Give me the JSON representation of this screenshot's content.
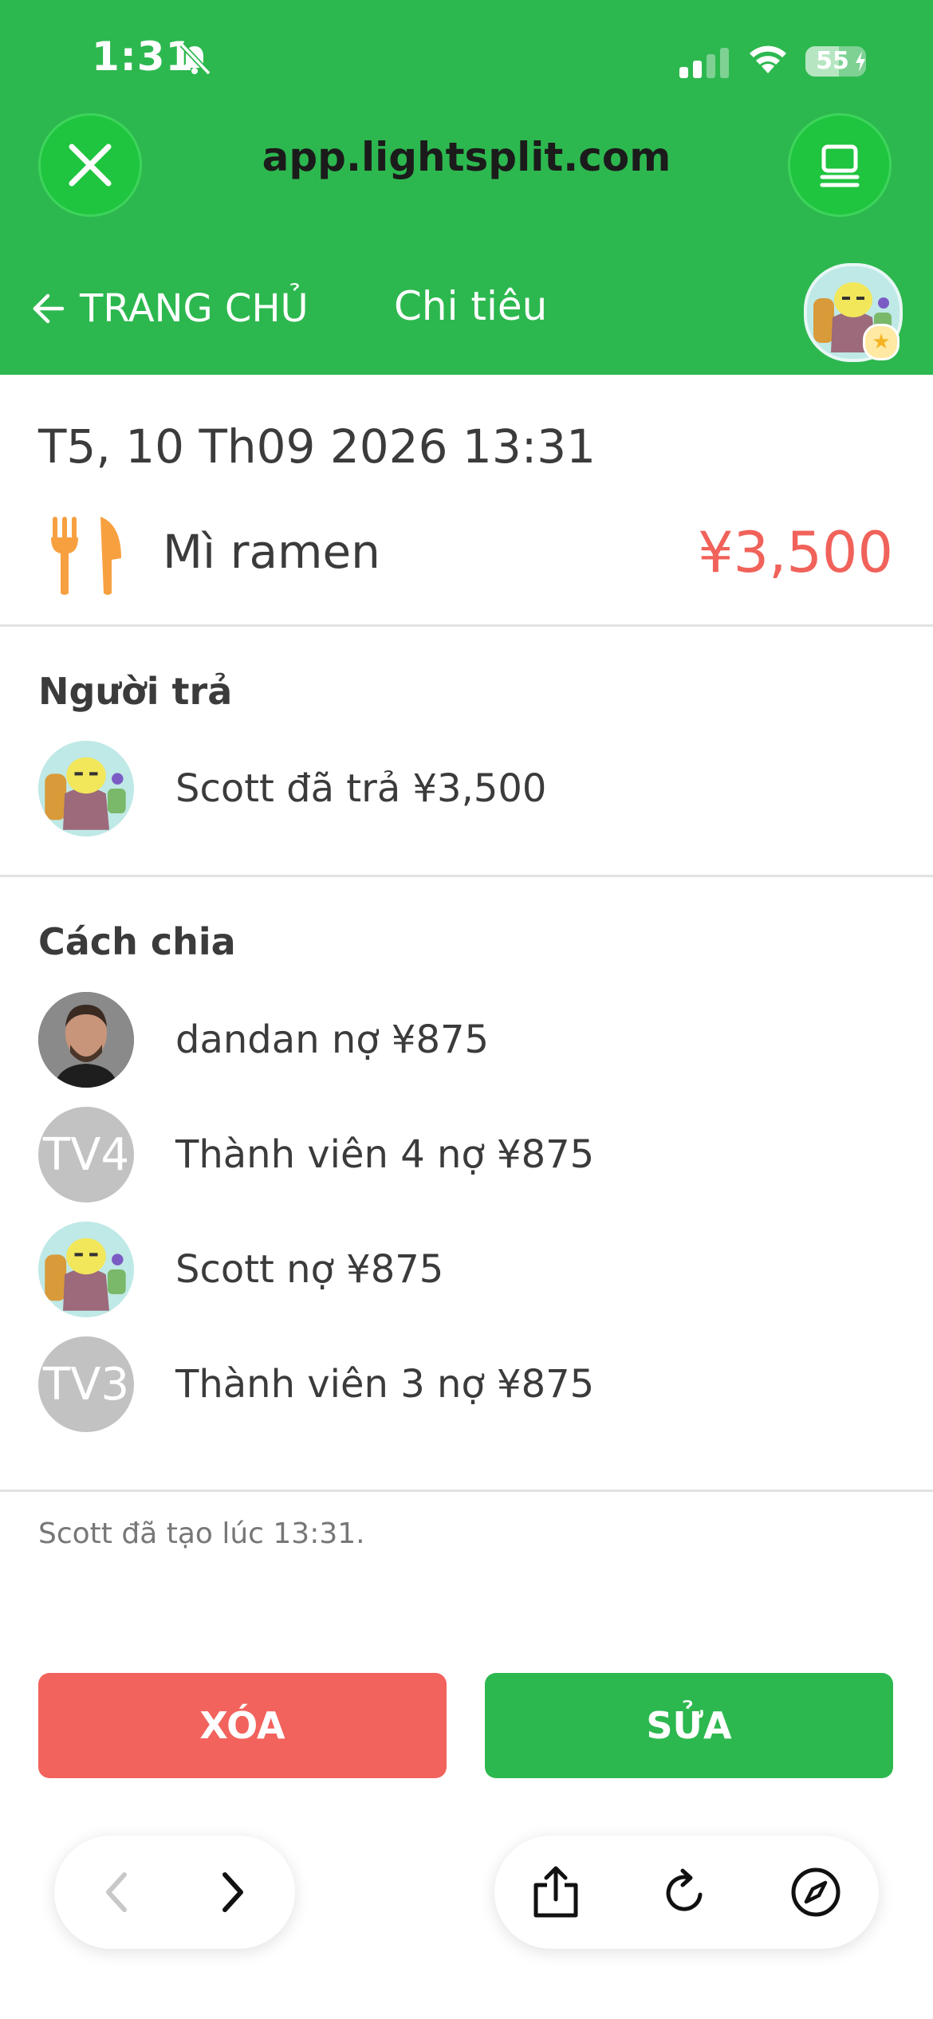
{
  "status_bar": {
    "time": "1:31",
    "battery": "55",
    "battery_level": 0.55
  },
  "browser": {
    "url": "app.lightsplit.com"
  },
  "nav": {
    "back_label": "TRANG CHỦ",
    "title": "Chi tiêu"
  },
  "expense": {
    "date": "T5, 10 Th09 2026 13:31",
    "name": "Mì ramen",
    "amount": "¥3,500",
    "category_icon": "fork-knife-icon"
  },
  "payer": {
    "title": "Người trả",
    "items": [
      {
        "text": "Scott đã trả ¥3,500",
        "avatar": "cartoon"
      }
    ]
  },
  "split": {
    "title": "Cách chia",
    "items": [
      {
        "text": "dandan nợ ¥875",
        "avatar": "photo"
      },
      {
        "text": "Thành viên 4 nợ ¥875",
        "avatar_initials": "TV4"
      },
      {
        "text": "Scott nợ ¥875",
        "avatar": "cartoon"
      },
      {
        "text": "Thành viên 3 nợ ¥875",
        "avatar_initials": "TV3"
      }
    ]
  },
  "footer_note": "Scott đã tạo lúc 13:31.",
  "actions": {
    "delete_label": "XÓA",
    "edit_label": "SỬA"
  },
  "colors": {
    "primary": "#2db84f",
    "danger": "#f2635d",
    "amount": "#f0625a",
    "category": "#f7a040"
  }
}
